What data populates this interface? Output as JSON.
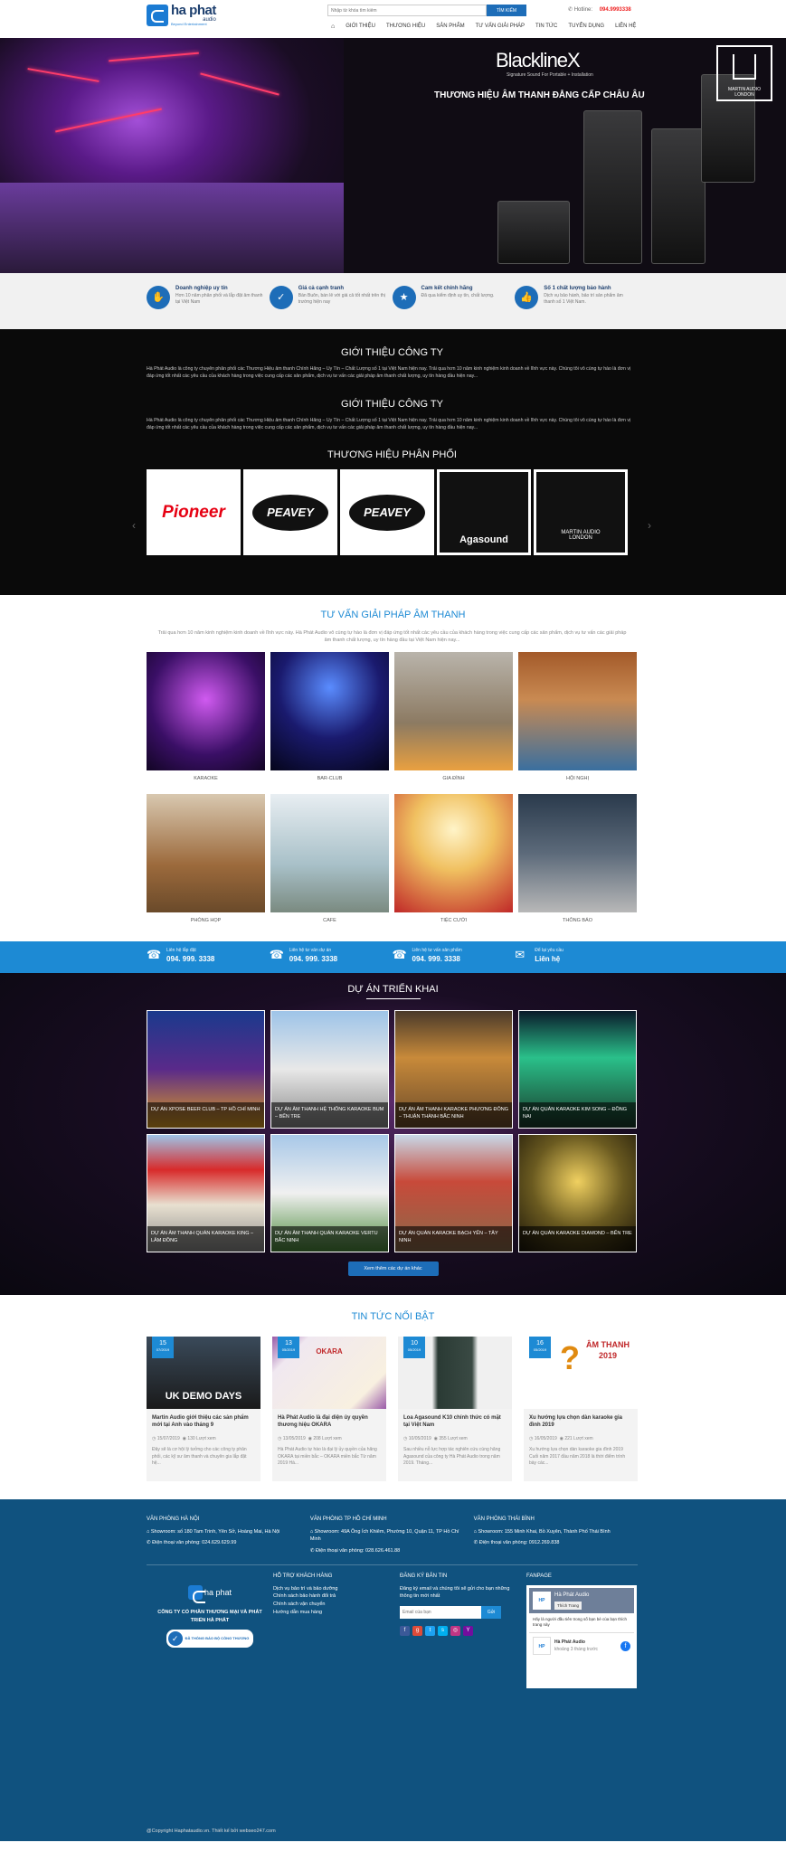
{
  "header": {
    "logo": {
      "line1": "ha phat",
      "line2": "audio",
      "line3": "Beyond Entertainment"
    },
    "search": {
      "placeholder": "Nhập từ khóa tìm kiếm",
      "button": "TÌM KIẾM"
    },
    "hotline_label": "Hotline:",
    "hotline_number": "094.9993338",
    "nav": [
      "GIỚI THIỆU",
      "THƯƠNG HIỆU",
      "SẢN PHẨM",
      "TƯ VẤN GIẢI PHÁP",
      "TIN TỨC",
      "TUYỂN DỤNG",
      "LIÊN HỆ"
    ]
  },
  "hero": {
    "brand": "BlacklineX",
    "tagline": "Signature Sound For Portable + Installation",
    "headline": "THƯƠNG HIỆU ÂM THANH ĐẲNG CẤP CHÂU ÂU",
    "martin": "MARTIN AUDIO LONDON"
  },
  "usp": [
    {
      "title": "Doanh nghiệp uy tín",
      "desc": "Hơn 10 năm phân phối và lắp đặt âm thanh tại Việt Nam",
      "icon": "handshake-icon"
    },
    {
      "title": "Giá cả cạnh tranh",
      "desc": "Bán Buôn, bán lẻ với giá cả tốt nhất trên thị trường hiện nay",
      "icon": "shield-icon"
    },
    {
      "title": "Cam kết chính hãng",
      "desc": "Đã qua kiểm định uy tín, chất lượng.",
      "icon": "award-icon"
    },
    {
      "title": "Số 1 chất lượng bảo hành",
      "desc": "Dịch vụ bảo hành, bảo trì sản phẩm âm thanh số 1 Việt Nam.",
      "icon": "thumbs-up-icon"
    }
  ],
  "intro": {
    "title1": "GIỚI THIỆU CÔNG TY",
    "text1": "Hà Phát Audio là công ty chuyên phân phối các Thương Hiệu âm thanh Chính Hãng – Uy Tín – Chất Lượng số 1 tại Việt Nam hiện nay. Trải qua hơn 10 năm kinh nghiệm kinh doanh về lĩnh vực này. Chúng tôi vô cùng tự hào là đơn vị đáp ứng tốt nhất các yêu cầu của khách hàng trong việc cung cấp các sản phẩm, dịch vụ tư vấn các giải pháp âm thanh chất lượng, uy tín hàng đầu hiện nay...",
    "title2": "GIỚI THIỆU CÔNG TY",
    "text2": "Hà Phát Audio là công ty chuyên phân phối các Thương Hiệu âm thanh Chính Hãng – Uy Tín – Chất Lượng số 1 tại Việt Nam hiện nay. Trải qua hơn 10 năm kinh nghiệm kinh doanh về lĩnh vực này. Chúng tôi vô cùng tự hào là đơn vị đáp ứng tốt nhất các yêu cầu của khách hàng trong việc cung cấp các sản phẩm, dịch vụ tư vấn các giải pháp âm thanh chất lượng, uy tín hàng đầu hiện nay...",
    "brands_title": "THƯƠNG HIỆU PHÂN PHỐI",
    "brands": [
      "Pioneer",
      "PEAVEY",
      "PEAVEY",
      "Agasound",
      "MARTIN AUDIO LONDON"
    ]
  },
  "solutions": {
    "title": "TƯ VẤN GIẢI PHÁP ÂM THANH",
    "desc": "Trải qua hơn 10 năm kinh nghiệm kinh doanh về lĩnh vực này. Hà Phát Audio vô cùng tự hào là đơn vị đáp ứng tốt nhất các yêu cầu của khách hàng trong việc cung cấp các sản phẩm, dịch vụ tư vấn các giải pháp âm thanh chất lượng, uy tín hàng đầu tại Việt Nam hiện nay...",
    "items": [
      "KARAOKE",
      "BAR-CLUB",
      "GIA ĐÌNH",
      "HỘI NGHỊ",
      "PHÒNG HỌP",
      "CAFE",
      "TIỆC CƯỚI",
      "THÔNG BÁO"
    ]
  },
  "contact_bar": [
    {
      "label": "Liên hệ lắp đặt",
      "value": "094. 999. 3338",
      "icon": "phone-icon"
    },
    {
      "label": "Liên hệ tư vấn dự án",
      "value": "094. 999. 3338",
      "icon": "phone-icon"
    },
    {
      "label": "Liên hệ tư vấn sản phẩm",
      "value": "094. 999. 3338",
      "icon": "phone-icon"
    },
    {
      "label": "Để lại yêu cầu",
      "value": "Liên hệ",
      "icon": "chat-icon"
    }
  ],
  "projects": {
    "title": "DỰ ÁN TRIỂN KHAI",
    "items": [
      "DỰ ÁN XPOSE BEER CLUB – TP HỒ CHÍ MINH",
      "DỰ ÁN ÂM THANH HỆ THỐNG KARAOKE BUM – BẾN TRE",
      "DỰ ÁN ÂM THANH KARAOKE PHƯƠNG ĐÔNG – THUẬN THÀNH BẮC NINH",
      "DỰ ÁN QUÁN KARAOKE KIM SONG – ĐỒNG NAI",
      "DỰ ÁN ÂM THANH QUÁN KARAOKE KING – LÂM ĐỒNG",
      "DỰ ÁN ÂM THANH QUÁN KARAOKE VERTU BẮC NINH",
      "DỰ ÁN QUÁN KARAOKE BẠCH YẾN – TÂY NINH",
      "DỰ ÁN QUÁN KARAOKE DIAMOND – BẾN TRE"
    ],
    "more": "Xem thêm các dự án khác"
  },
  "news": {
    "title": "TIN TỨC NỔI BẬT",
    "items": [
      {
        "day": "15",
        "month": "07/2019",
        "title": "Martin Audio giới thiệu các sản phẩm mới tại Anh vào tháng 9",
        "date": "15/07/2019",
        "views": "130 Lượt xem",
        "desc": "Đây sẽ là cơ hội lý tưởng cho các công ty phân phối, các kỹ sư âm thanh và chuyên gia lắp đặt hệ..."
      },
      {
        "day": "13",
        "month": "05/2019",
        "title": "Hà Phát Audio là đại diện ủy quyền thương hiệu OKARA",
        "date": "13/05/2019",
        "views": "208 Lượt xem",
        "desc": "Hà Phát Audio tự hào là đại lý ủy quyền của hãng OKARA tại miền bắc – OKARA miền bắc Từ năm 2019 Hà..."
      },
      {
        "day": "10",
        "month": "05/2019",
        "title": "Loa Agasound K10 chính thức có mặt tại Việt Nam",
        "date": "10/05/2019",
        "views": "355 Lượt xem",
        "desc": "Sau nhiều nỗ lực hợp tác nghiên cứu cùng hãng Agasound của công ty Hà Phát Audio trong năm 2019. Tháng..."
      },
      {
        "day": "16",
        "month": "05/2019",
        "title": "Xu hướng lựa chọn dàn karaoke gia đình 2019",
        "date": "16/05/2019",
        "views": "221 Lượt xem",
        "desc": "Xu hướng lựa chọn dàn karaoke gia đình 2019 Cuối năm 2017 đầu năm 2018 là thời điểm trình bày các..."
      }
    ],
    "img_text1": "UK DEMO DAYS",
    "img_text2": "OKARA",
    "img_text3": "ÂM THANH 2019"
  },
  "footer": {
    "offices": [
      {
        "title": "VĂN PHÒNG HÀ NỘI",
        "addr": "Showroom: số 180 Tam Trinh, Yên Sở, Hoàng Mai, Hà Nội",
        "phone": "Điện thoại văn phòng: 024.629.629.99"
      },
      {
        "title": "VĂN PHÒNG TP HỒ CHÍ MINH",
        "addr": "Showroom: 49A Ông Ích Khiêm, Phường 10, Quận 11, TP Hồ Chí Minh",
        "phone": "Điện thoại văn phòng: 028.626.461.88"
      },
      {
        "title": "VĂN PHÒNG THÁI BÌNH",
        "addr": "Showroom: 155 Minh Khai, Bồ Xuyên, Thành Phố Thái Bình",
        "phone": "Điện thoại văn phòng: 0912.269.838"
      }
    ],
    "company": "CÔNG TY CỔ PHẦN THƯƠNG MẠI VÀ PHÁT TRIỂN HÀ PHÁT",
    "bct": "ĐÃ THÔNG BÁO BỘ CÔNG THƯƠNG",
    "support_title": "HỖ TRỢ KHÁCH HÀNG",
    "support_links": [
      "Dịch vụ bảo trì và bảo dưỡng",
      "Chính sách bảo hành đổi trả",
      "Chính sách vận chuyển",
      "Hướng dẫn mua hàng"
    ],
    "subscribe_title": "ĐĂNG KÝ BẢN TIN",
    "subscribe_desc": "Đăng ký email và chúng tôi sẽ gửi cho bạn những thông tin mới nhất",
    "subscribe_placeholder": "Email của bạn",
    "subscribe_button": "Gửi",
    "fanpage_title": "FANPAGE",
    "fan_name": "Hà Phát Audio",
    "fan_like": "Thích Trang",
    "fan_text": "Hãy là người đầu tiên trong số bạn bè của bạn thích trang này",
    "fan_post_name": "Hà Phát Audio",
    "fan_post_time": "khoảng 3 tháng trước",
    "copyright": "@Copyright Haphataudio.vn. Thiết kế bởi webseo247.com"
  },
  "colors": {
    "primary": "#1d6db8",
    "accent": "#1d8ad4",
    "footer": "#10527f",
    "hotline": "#e22222"
  }
}
